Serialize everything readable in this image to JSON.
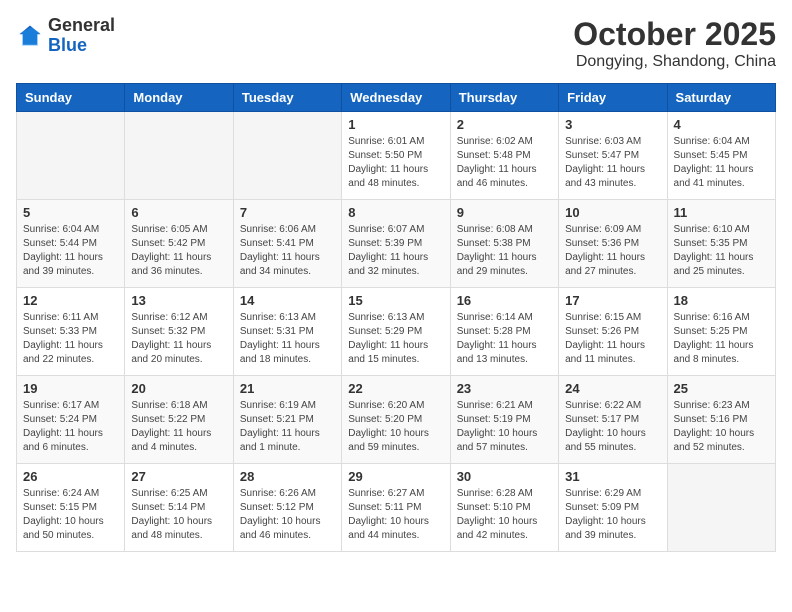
{
  "header": {
    "logo_general": "General",
    "logo_blue": "Blue",
    "month_title": "October 2025",
    "location": "Dongying, Shandong, China"
  },
  "calendar": {
    "days_of_week": [
      "Sunday",
      "Monday",
      "Tuesday",
      "Wednesday",
      "Thursday",
      "Friday",
      "Saturday"
    ],
    "weeks": [
      [
        {
          "day": "",
          "info": ""
        },
        {
          "day": "",
          "info": ""
        },
        {
          "day": "",
          "info": ""
        },
        {
          "day": "1",
          "info": "Sunrise: 6:01 AM\nSunset: 5:50 PM\nDaylight: 11 hours\nand 48 minutes."
        },
        {
          "day": "2",
          "info": "Sunrise: 6:02 AM\nSunset: 5:48 PM\nDaylight: 11 hours\nand 46 minutes."
        },
        {
          "day": "3",
          "info": "Sunrise: 6:03 AM\nSunset: 5:47 PM\nDaylight: 11 hours\nand 43 minutes."
        },
        {
          "day": "4",
          "info": "Sunrise: 6:04 AM\nSunset: 5:45 PM\nDaylight: 11 hours\nand 41 minutes."
        }
      ],
      [
        {
          "day": "5",
          "info": "Sunrise: 6:04 AM\nSunset: 5:44 PM\nDaylight: 11 hours\nand 39 minutes."
        },
        {
          "day": "6",
          "info": "Sunrise: 6:05 AM\nSunset: 5:42 PM\nDaylight: 11 hours\nand 36 minutes."
        },
        {
          "day": "7",
          "info": "Sunrise: 6:06 AM\nSunset: 5:41 PM\nDaylight: 11 hours\nand 34 minutes."
        },
        {
          "day": "8",
          "info": "Sunrise: 6:07 AM\nSunset: 5:39 PM\nDaylight: 11 hours\nand 32 minutes."
        },
        {
          "day": "9",
          "info": "Sunrise: 6:08 AM\nSunset: 5:38 PM\nDaylight: 11 hours\nand 29 minutes."
        },
        {
          "day": "10",
          "info": "Sunrise: 6:09 AM\nSunset: 5:36 PM\nDaylight: 11 hours\nand 27 minutes."
        },
        {
          "day": "11",
          "info": "Sunrise: 6:10 AM\nSunset: 5:35 PM\nDaylight: 11 hours\nand 25 minutes."
        }
      ],
      [
        {
          "day": "12",
          "info": "Sunrise: 6:11 AM\nSunset: 5:33 PM\nDaylight: 11 hours\nand 22 minutes."
        },
        {
          "day": "13",
          "info": "Sunrise: 6:12 AM\nSunset: 5:32 PM\nDaylight: 11 hours\nand 20 minutes."
        },
        {
          "day": "14",
          "info": "Sunrise: 6:13 AM\nSunset: 5:31 PM\nDaylight: 11 hours\nand 18 minutes."
        },
        {
          "day": "15",
          "info": "Sunrise: 6:13 AM\nSunset: 5:29 PM\nDaylight: 11 hours\nand 15 minutes."
        },
        {
          "day": "16",
          "info": "Sunrise: 6:14 AM\nSunset: 5:28 PM\nDaylight: 11 hours\nand 13 minutes."
        },
        {
          "day": "17",
          "info": "Sunrise: 6:15 AM\nSunset: 5:26 PM\nDaylight: 11 hours\nand 11 minutes."
        },
        {
          "day": "18",
          "info": "Sunrise: 6:16 AM\nSunset: 5:25 PM\nDaylight: 11 hours\nand 8 minutes."
        }
      ],
      [
        {
          "day": "19",
          "info": "Sunrise: 6:17 AM\nSunset: 5:24 PM\nDaylight: 11 hours\nand 6 minutes."
        },
        {
          "day": "20",
          "info": "Sunrise: 6:18 AM\nSunset: 5:22 PM\nDaylight: 11 hours\nand 4 minutes."
        },
        {
          "day": "21",
          "info": "Sunrise: 6:19 AM\nSunset: 5:21 PM\nDaylight: 11 hours\nand 1 minute."
        },
        {
          "day": "22",
          "info": "Sunrise: 6:20 AM\nSunset: 5:20 PM\nDaylight: 10 hours\nand 59 minutes."
        },
        {
          "day": "23",
          "info": "Sunrise: 6:21 AM\nSunset: 5:19 PM\nDaylight: 10 hours\nand 57 minutes."
        },
        {
          "day": "24",
          "info": "Sunrise: 6:22 AM\nSunset: 5:17 PM\nDaylight: 10 hours\nand 55 minutes."
        },
        {
          "day": "25",
          "info": "Sunrise: 6:23 AM\nSunset: 5:16 PM\nDaylight: 10 hours\nand 52 minutes."
        }
      ],
      [
        {
          "day": "26",
          "info": "Sunrise: 6:24 AM\nSunset: 5:15 PM\nDaylight: 10 hours\nand 50 minutes."
        },
        {
          "day": "27",
          "info": "Sunrise: 6:25 AM\nSunset: 5:14 PM\nDaylight: 10 hours\nand 48 minutes."
        },
        {
          "day": "28",
          "info": "Sunrise: 6:26 AM\nSunset: 5:12 PM\nDaylight: 10 hours\nand 46 minutes."
        },
        {
          "day": "29",
          "info": "Sunrise: 6:27 AM\nSunset: 5:11 PM\nDaylight: 10 hours\nand 44 minutes."
        },
        {
          "day": "30",
          "info": "Sunrise: 6:28 AM\nSunset: 5:10 PM\nDaylight: 10 hours\nand 42 minutes."
        },
        {
          "day": "31",
          "info": "Sunrise: 6:29 AM\nSunset: 5:09 PM\nDaylight: 10 hours\nand 39 minutes."
        },
        {
          "day": "",
          "info": ""
        }
      ]
    ]
  }
}
